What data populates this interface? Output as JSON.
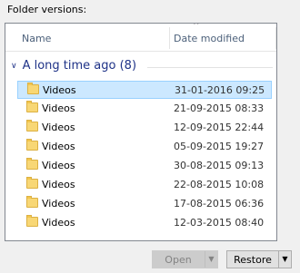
{
  "dialog": {
    "heading": "Folder versions:"
  },
  "list": {
    "columns": {
      "name": "Name",
      "date": "Date modified"
    },
    "group": {
      "label": "A long time ago (8)"
    },
    "rows": [
      {
        "name": "Videos",
        "date": "31-01-2016 09:25",
        "selected": true
      },
      {
        "name": "Videos",
        "date": "21-09-2015 08:33"
      },
      {
        "name": "Videos",
        "date": "12-09-2015 22:44"
      },
      {
        "name": "Videos",
        "date": "05-09-2015 19:27"
      },
      {
        "name": "Videos",
        "date": "30-08-2015 09:13"
      },
      {
        "name": "Videos",
        "date": "22-08-2015 10:08"
      },
      {
        "name": "Videos",
        "date": "17-08-2015 06:36"
      },
      {
        "name": "Videos",
        "date": "12-03-2015 08:40"
      }
    ]
  },
  "buttons": {
    "open": {
      "label": "Open",
      "enabled": false
    },
    "restore": {
      "label": "Restore",
      "enabled": true
    }
  },
  "icons": {
    "folder": "folder-icon",
    "group_chevron": "chevron-down-icon",
    "dropdown": "triangle-down-icon",
    "sort": "sort-caret-icon"
  },
  "colors": {
    "selection_bg": "#cce8ff",
    "selection_border": "#99d1ff",
    "group_text": "#1e3287",
    "folder": "#f8d775"
  }
}
